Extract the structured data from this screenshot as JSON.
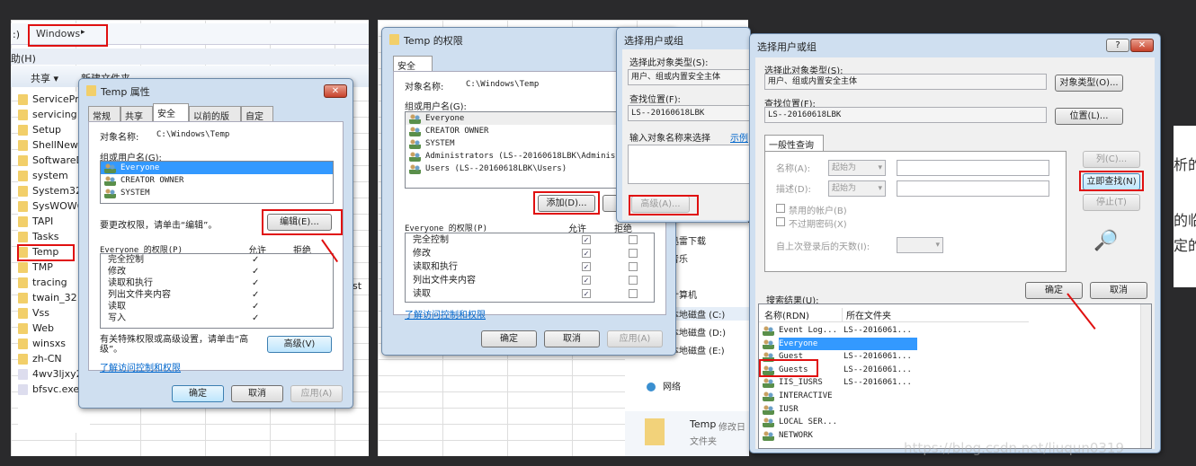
{
  "explorer": {
    "breadcrumb_prefix": ":)",
    "breadcrumb": "Windows",
    "menu_help": "助(H)",
    "toolbar_share": "共享 ▾",
    "toolbar_newfolder": "新建文件夹",
    "files": [
      "ServicePro",
      "servicing",
      "Setup",
      "ShellNew",
      "SoftwareD",
      "system",
      "System32",
      "SysWOW6",
      "TAPI",
      "Tasks",
      "Temp",
      "TMP",
      "tracing",
      "twain_32",
      "Vss",
      "Web",
      "winsxs",
      "zh-CN",
      "4wv3ljxy24",
      "bfsvc.exe"
    ],
    "side_text": "st"
  },
  "props": {
    "title": "Temp 属性",
    "tabs": [
      "常规",
      "共享",
      "安全",
      "以前的版本",
      "自定义"
    ],
    "object_label": "对象名称:",
    "object_value": "C:\\Windows\\Temp",
    "group_label": "组或用户名(G):",
    "users": [
      "Everyone",
      "CREATOR OWNER",
      "SYSTEM"
    ],
    "edit_hint": "要更改权限，请单击“编辑”。",
    "edit_btn": "编辑(E)...",
    "perm_label": "Everyone 的权限(P)",
    "allow": "允许",
    "deny": "拒绝",
    "perms": [
      "完全控制",
      "修改",
      "读取和执行",
      "列出文件夹内容",
      "读取",
      "写入"
    ],
    "check": "✓",
    "adv_hint": "有关特殊权限或高级设置，请单击“高级”。",
    "adv_btn": "高级(V)",
    "learn": "了解访问控制和权限",
    "ok": "确定",
    "cancel": "取消",
    "apply": "应用(A)"
  },
  "perm": {
    "title": "Temp 的权限",
    "tab": "安全",
    "object_label": "对象名称:",
    "object_value": "C:\\Windows\\Temp",
    "group_label": "组或用户名(G):",
    "users": [
      "Everyone",
      "CREATOR OWNER",
      "SYSTEM",
      "Administrators (LS--20160618LBK\\Administr",
      "Users (LS--20160618LBK\\Users)"
    ],
    "add_btn": "添加(D)...",
    "remove_btn": "删",
    "perm_label": "Everyone 的权限(P)",
    "allow": "允许",
    "deny": "拒绝",
    "perms": [
      "完全控制",
      "修改",
      "读取和执行",
      "列出文件夹内容",
      "读取"
    ],
    "learn": "了解访问控制和权限",
    "ok": "确定",
    "cancel": "取消",
    "apply": "应用(A)"
  },
  "select_back": {
    "title": "选择用户或组",
    "type_label": "选择此对象类型(S):",
    "type_value": "用户、组或内置安全主体",
    "loc_label": "查找位置(F):",
    "loc_value": "LS--20160618LBK",
    "enter_label": "输入对象名称来选择",
    "example": "示例",
    "adv_btn": "高级(A)..."
  },
  "nav": {
    "items": [
      "迅雷下载",
      "音乐",
      "计算机",
      "本地磁盘 (C:)",
      "本地磁盘 (D:)",
      "本地磁盘 (E:)",
      "网络"
    ],
    "detail_name": "Temp",
    "detail_meta": "修改日",
    "detail_type": "文件夹"
  },
  "select": {
    "title": "选择用户或组",
    "help": "?",
    "close": "✕",
    "type_label": "选择此对象类型(S):",
    "type_value": "用户、组或内置安全主体",
    "type_btn": "对象类型(O)...",
    "loc_label": "查找位置(F):",
    "loc_value": "LS--20160618LBK",
    "loc_btn": "位置(L)...",
    "tab": "一般性查询",
    "name_label": "名称(A):",
    "desc_label": "描述(D):",
    "starts": "起始为",
    "disabled": "禁用的帐户(B)",
    "noexpire": "不过期密码(X)",
    "days": "自上次登录后的天数(I):",
    "col_btn": "列(C)...",
    "find_btn": "立即查找(N)",
    "stop_btn": "停止(T)",
    "ok": "确定",
    "cancel": "取消",
    "results_label": "搜索结果(U):",
    "col_name": "名称(RDN)",
    "col_folder": "所在文件夹",
    "results": [
      {
        "name": "Event Log...",
        "folder": "LS--2016061..."
      },
      {
        "name": "Everyone",
        "folder": ""
      },
      {
        "name": "Guest",
        "folder": "LS--2016061..."
      },
      {
        "name": "Guests",
        "folder": "LS--2016061..."
      },
      {
        "name": "IIS_IUSRS",
        "folder": "LS--2016061..."
      },
      {
        "name": "INTERACTIVE",
        "folder": ""
      },
      {
        "name": "IUSR",
        "folder": ""
      },
      {
        "name": "LOCAL SER...",
        "folder": ""
      },
      {
        "name": "NETWORK",
        "folder": ""
      }
    ]
  },
  "right_fragments": [
    "析的",
    "的临",
    "定的"
  ],
  "watermark": "https://blog.csdn.net/liuqun0319",
  "colors": {
    "highlight": "#e01010",
    "selection": "#3399ff"
  }
}
